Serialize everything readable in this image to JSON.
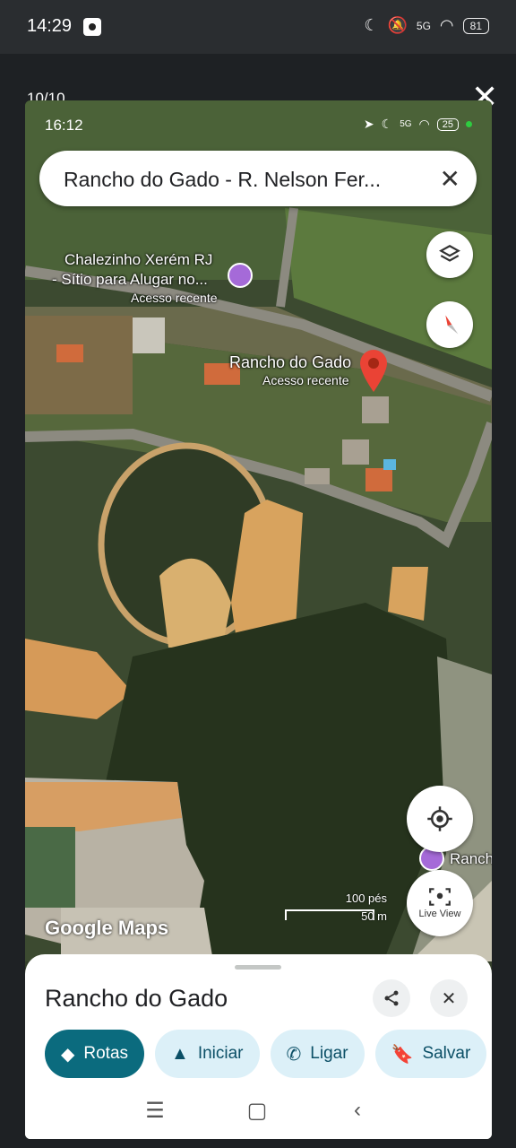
{
  "outer_status": {
    "time": "14:29",
    "network": "5G",
    "battery": "81"
  },
  "viewer": {
    "counter": "10/10",
    "close_glyph": "✕"
  },
  "inner_status": {
    "time": "16:12",
    "network": "5G",
    "battery": "25"
  },
  "search": {
    "query": "Rancho do Gado - R. Nelson Fer...",
    "clear_glyph": "✕"
  },
  "map": {
    "labels": {
      "chalet_line1": "Chalezinho Xerém RJ",
      "chalet_line2": "- Sítio para Alugar no...",
      "chalet_recent": "Acesso recente",
      "place_name": "Rancho do Gado",
      "place_recent": "Acesso recente",
      "edge_place": "Ranch"
    },
    "attribution": "Google Maps",
    "scale_imperial": "100 pés",
    "scale_metric": "50 m",
    "live_view_label": "Live View"
  },
  "sheet": {
    "title": "Rancho do Gado",
    "chips": [
      {
        "label": "Rotas",
        "icon": "directions-icon"
      },
      {
        "label": "Iniciar",
        "icon": "navigation-arrow-icon"
      },
      {
        "label": "Ligar",
        "icon": "phone-icon"
      },
      {
        "label": "Salvar",
        "icon": "bookmark-icon"
      }
    ]
  },
  "colors": {
    "primary_chip": "#0b6b7e",
    "secondary_chip": "#dcf0f8",
    "pin_red": "#ea4335",
    "poi_purple": "#a56ad8"
  }
}
